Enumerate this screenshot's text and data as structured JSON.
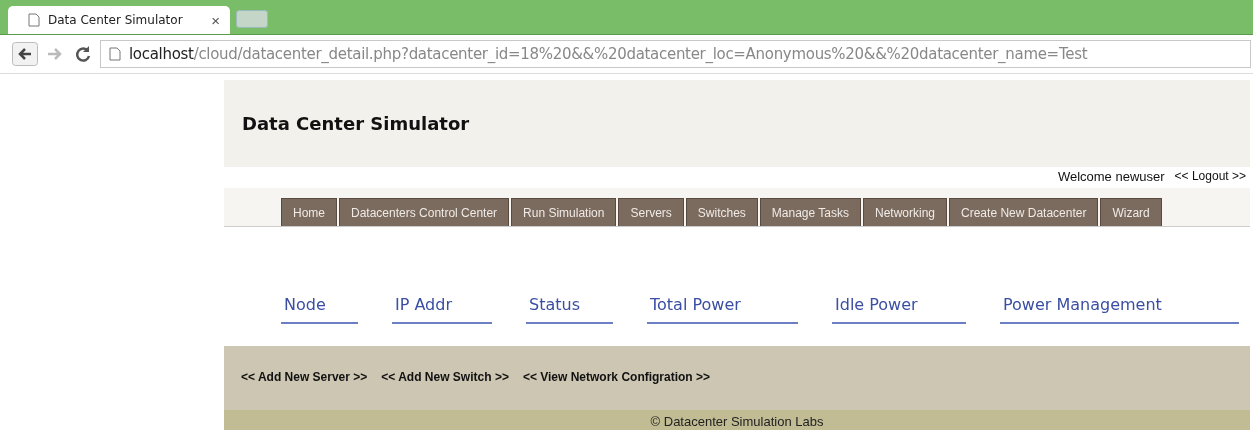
{
  "browser": {
    "tab": {
      "title": "Data Center Simulator",
      "close": "×"
    },
    "url": {
      "host": "localhost",
      "path": "/cloud/datacenter_detail.php?datacenter_id=18%20&&%20datacenter_loc=Anonymous%20&&%20datacenter_name=Test"
    }
  },
  "header": {
    "title": "Data Center Simulator"
  },
  "userbar": {
    "welcome": "Welcome newuser",
    "logout": "<< Logout >>"
  },
  "nav": [
    {
      "label": "Home"
    },
    {
      "label": "Datacenters Control Center"
    },
    {
      "label": "Run Simulation"
    },
    {
      "label": "Servers"
    },
    {
      "label": "Switches"
    },
    {
      "label": "Manage Tasks"
    },
    {
      "label": "Networking"
    },
    {
      "label": "Create New Datacenter"
    },
    {
      "label": "Wizard"
    }
  ],
  "table": {
    "columns": [
      "Node",
      "IP Addr",
      "Status",
      "Total Power",
      "Idle Power",
      "Power Management"
    ]
  },
  "actions": [
    "<< Add New Server >>",
    "<< Add New Switch >>",
    "<< View Network Configration >>"
  ],
  "footer": "© Datacenter Simulation Labs"
}
